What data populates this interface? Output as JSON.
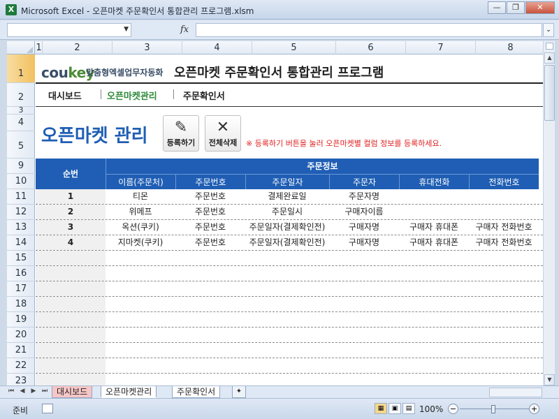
{
  "window": {
    "app_icon": "X",
    "title": "Microsoft Excel - 오픈마켓 주문확인서 통합관리 프로그램.xlsm",
    "buttons": {
      "minimize": "—",
      "restore": "❐",
      "close": "✕"
    }
  },
  "formula_bar": {
    "name_box": "",
    "fx_label": "fx",
    "formula": ""
  },
  "columns": [
    "1",
    "2",
    "3",
    "4",
    "5",
    "6",
    "7",
    "8"
  ],
  "rows": [
    "1",
    "2",
    "3",
    "4",
    "5",
    "9",
    "10",
    "11",
    "12",
    "13",
    "14",
    "15",
    "16",
    "17",
    "18",
    "19",
    "20",
    "21",
    "22",
    "23"
  ],
  "header": {
    "brand": "cou",
    "brand_k": "key",
    "brand_sub": "맞춤형엑셀업무자동화",
    "title": "오픈마켓 주문확인서 통합관리 프로그램"
  },
  "nav": {
    "items": [
      "대시보드",
      "오픈마켓관리",
      "주문확인서"
    ]
  },
  "section": {
    "title": "오픈마켓 관리",
    "register_button": "등록하기",
    "delete_all_button": "전체삭제",
    "hint": "※ 등록하기 버튼을 눌러 오픈마켓별 컬럼 정보를 등록하세요."
  },
  "table": {
    "seq_header": "순번",
    "group_header": "주문정보",
    "headers": [
      "이름(주문처)",
      "주문번호",
      "주문일자",
      "주문자",
      "휴대전화",
      "전화번호"
    ],
    "rows": [
      {
        "seq": "1",
        "cells": [
          "티몬",
          "주문번호",
          "결제완료일",
          "주문자명",
          "",
          ""
        ]
      },
      {
        "seq": "2",
        "cells": [
          "위메프",
          "주문번호",
          "주문일시",
          "구매자이름",
          "",
          ""
        ]
      },
      {
        "seq": "3",
        "cells": [
          "옥션(쿠키)",
          "주문번호",
          "주문일자(결제확인전)",
          "구매자명",
          "구매자 휴대폰",
          "구매자 전화번호"
        ]
      },
      {
        "seq": "4",
        "cells": [
          "지마켓(쿠키)",
          "주문번호",
          "주문일자(결제확인전)",
          "구매자명",
          "구매자 휴대폰",
          "구매자 전화번호"
        ]
      }
    ]
  },
  "sheet_tabs": {
    "nav": [
      "⏮",
      "◀",
      "▶",
      "⏭"
    ],
    "tabs": [
      "대시보드",
      "오픈마켓관리",
      "주문확인서"
    ],
    "active": "오픈마켓관리"
  },
  "status": {
    "ready": "준비",
    "zoom": "100%",
    "zoom_minus": "−",
    "zoom_plus": "+"
  }
}
